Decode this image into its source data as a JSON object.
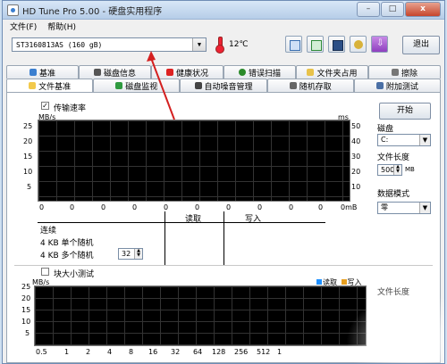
{
  "window": {
    "title": "HD Tune Pro 5.00 - 硬盘实用程序",
    "min": "–",
    "max": "□",
    "close": "x"
  },
  "menu": {
    "file": "文件(F)",
    "help": "帮助(H)"
  },
  "toolbar": {
    "drive": "ST3160813AS (160 gB)",
    "temperature": "12℃",
    "exit": "退出"
  },
  "tabs_row1": [
    "基准",
    "磁盘信息",
    "健康状况",
    "错误扫描",
    "文件夹占用",
    "擦除"
  ],
  "tabs_row2": [
    "文件基准",
    "磁盘监视",
    "自动噪音管理",
    "随机存取",
    "附加测试"
  ],
  "colors": {
    "accent": "#3b7fd0",
    "arrow": "#d42020",
    "read": "#1e90ff",
    "write": "#e8a020"
  },
  "benchmark": {
    "transfer_rate_label": "传输速率",
    "transfer_rate_checked": true,
    "mbs_unit": "MB/s",
    "ms_unit": "ms",
    "y_left": [
      "25",
      "20",
      "15",
      "10",
      "5"
    ],
    "y_right": [
      "50",
      "40",
      "30",
      "20",
      "10"
    ],
    "x_labels": [
      "0",
      "0",
      "0",
      "0",
      "0",
      "0",
      "0",
      "0",
      "0",
      "0"
    ],
    "x_last": "0mB",
    "read_label": "读取",
    "write_label": "写入",
    "stats": {
      "sequential": "连续",
      "kb4_single": "4 KB 单个随机",
      "kb4_multi": "4 KB 多个随机",
      "queue_depth": "32"
    }
  },
  "side": {
    "start": "开始",
    "disk_label": "磁盘",
    "disk_value": "C:",
    "file_length_label": "文件长度",
    "file_length_value": "500",
    "file_length_unit": "MB",
    "data_mode_label": "数据模式",
    "data_mode_value": "零",
    "file_length_label2": "文件长度"
  },
  "block": {
    "block_size_label": "块大小测试",
    "block_size_checked": false,
    "mbs_unit": "MB/s",
    "y_left": [
      "25",
      "20",
      "15",
      "10",
      "5"
    ],
    "legend_read": "读取",
    "legend_write": "写入",
    "x_labels": [
      "0.5",
      "1",
      "2",
      "4",
      "8",
      "16",
      "32",
      "64",
      "128",
      "256",
      "512",
      "1"
    ]
  }
}
